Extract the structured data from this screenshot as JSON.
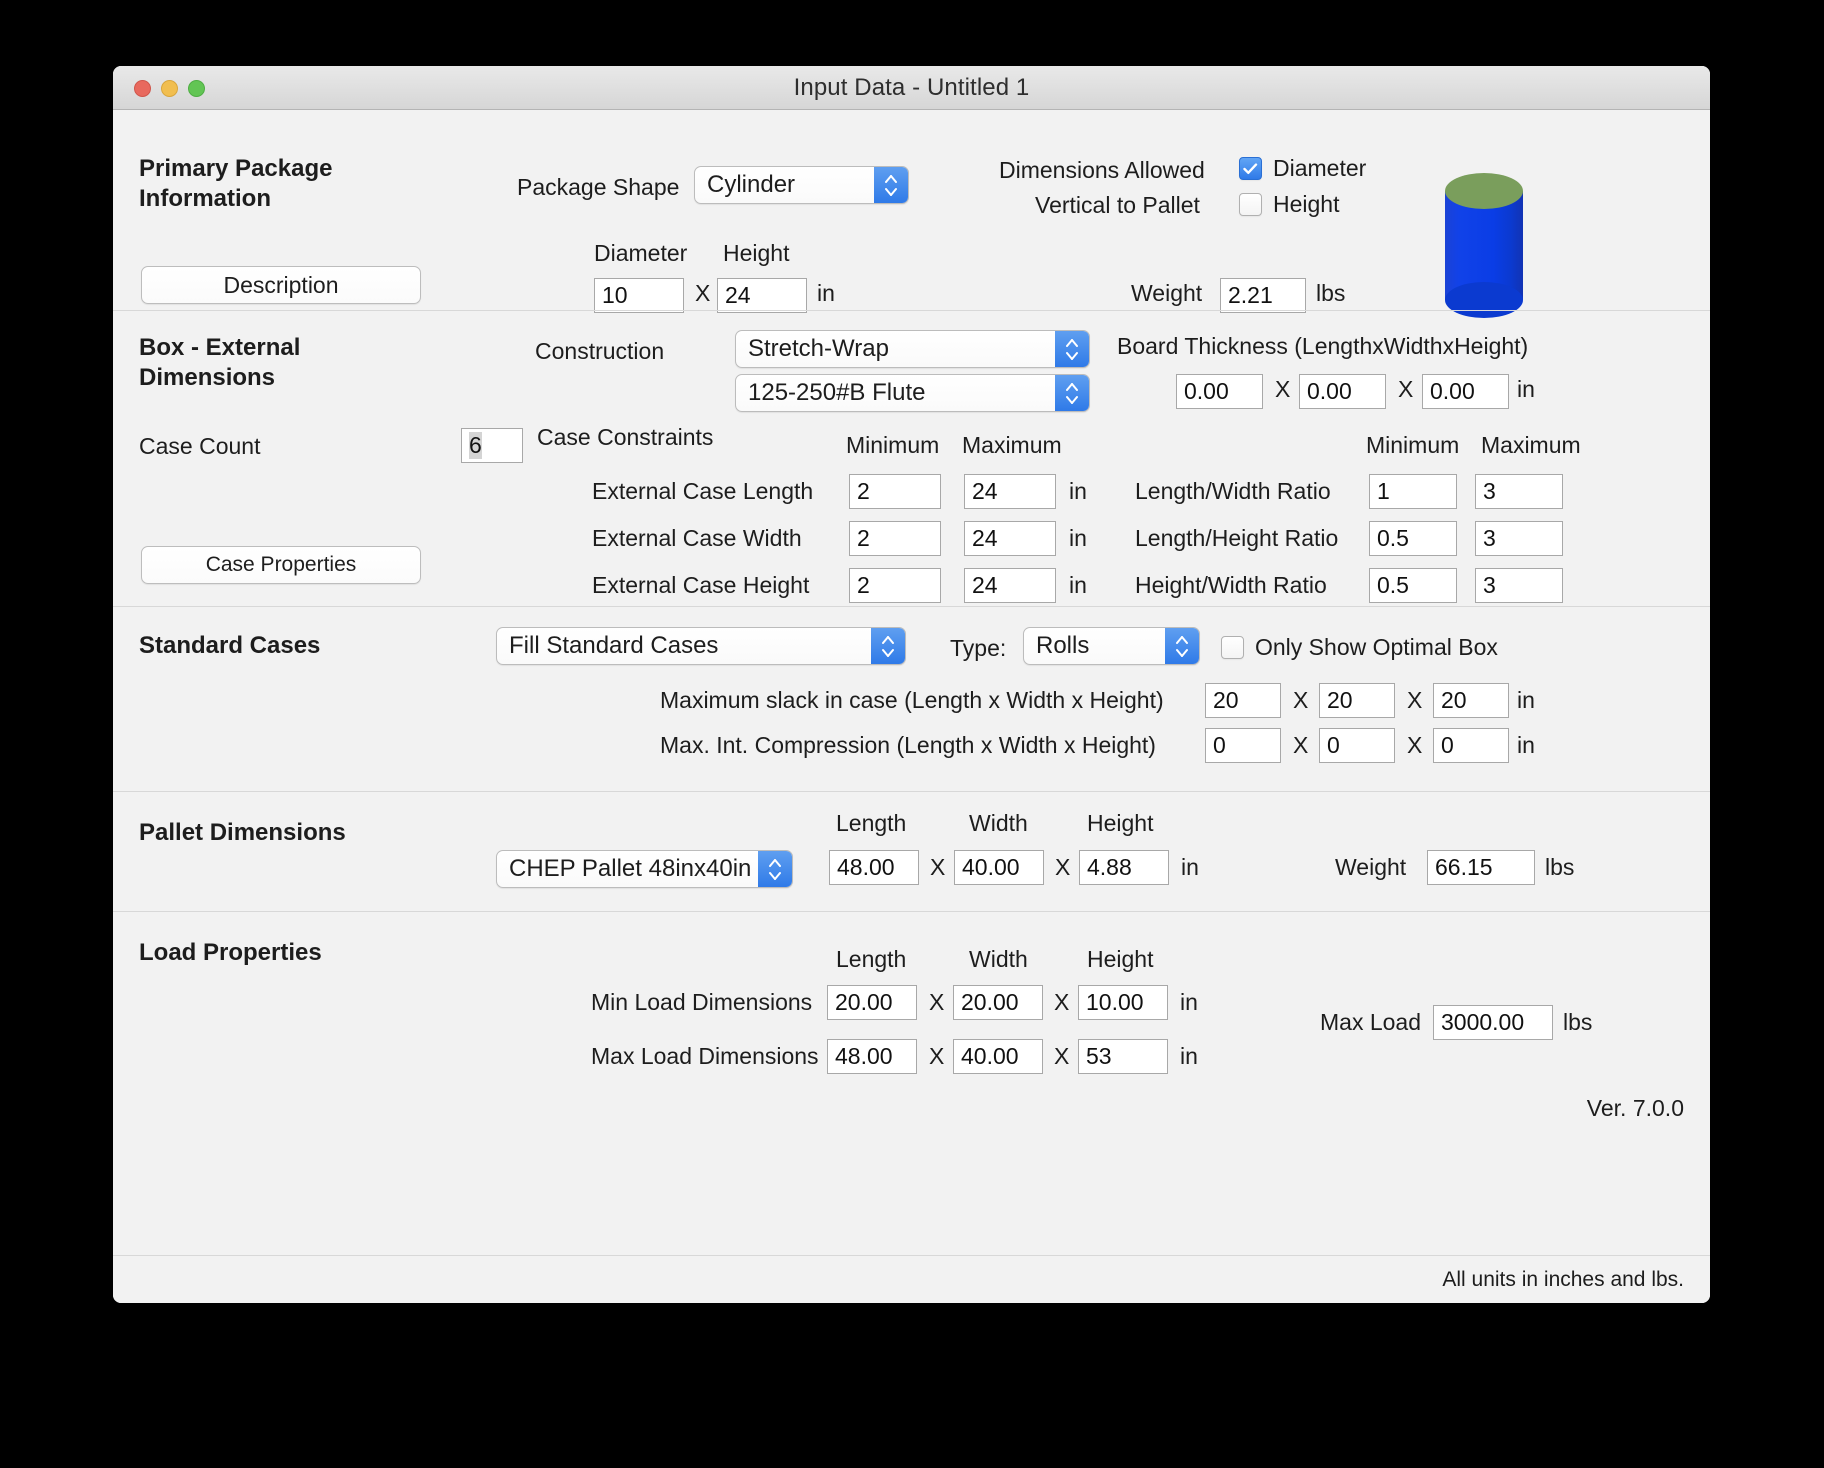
{
  "window": {
    "title": "Input Data - Untitled 1",
    "traffic_lights": [
      "close",
      "minimize",
      "zoom"
    ]
  },
  "primary_package": {
    "section_title": "Primary Package\nInformation",
    "description_button": "Description",
    "package_shape_label": "Package Shape",
    "package_shape_value": "Cylinder",
    "diameter_label": "Diameter",
    "height_label": "Height",
    "diameter_value": "10",
    "height_value": "24",
    "x_sep": "X",
    "unit_in": "in",
    "dims_allowed_line1": "Dimensions Allowed",
    "dims_allowed_line2": "Vertical to Pallet",
    "check_diameter_label": "Diameter",
    "check_diameter_checked": true,
    "check_height_label": "Height",
    "check_height_checked": false,
    "weight_label": "Weight",
    "weight_value": "2.21",
    "weight_unit": "lbs",
    "shape_preview": "cylinder",
    "shape_color_body": "#0a3de6",
    "shape_color_top": "#7a9e5c"
  },
  "box_external": {
    "section_title": "Box - External\nDimensions",
    "construction_label": "Construction",
    "construction_value": "Stretch-Wrap",
    "flute_value": "125-250#B Flute",
    "board_thickness_label": "Board Thickness (LengthxWidthxHeight)",
    "board_thickness": [
      "0.00",
      "0.00",
      "0.00"
    ],
    "board_thickness_unit": "in",
    "case_count_label": "Case Count",
    "case_count_value": "6",
    "case_properties_button": "Case Properties",
    "case_constraints_label": "Case Constraints",
    "minimum_header": "Minimum",
    "maximum_header": "Maximum",
    "constraints": [
      {
        "label": "External Case Length",
        "min": "2",
        "max": "24",
        "unit": "in"
      },
      {
        "label": "External Case Width",
        "min": "2",
        "max": "24",
        "unit": "in"
      },
      {
        "label": "External Case Height",
        "min": "2",
        "max": "24",
        "unit": "in"
      }
    ],
    "ratios_minimum_header": "Minimum",
    "ratios_maximum_header": "Maximum",
    "ratios": [
      {
        "label": "Length/Width Ratio",
        "min": "1",
        "max": "3"
      },
      {
        "label": "Length/Height Ratio",
        "min": "0.5",
        "max": "3"
      },
      {
        "label": "Height/Width Ratio",
        "min": "0.5",
        "max": "3"
      }
    ]
  },
  "standard_cases": {
    "section_title": "Standard Cases",
    "fill_mode_value": "Fill Standard Cases",
    "type_label": "Type:",
    "type_value": "Rolls",
    "only_optimal_label": "Only Show Optimal Box",
    "only_optimal_checked": false,
    "slack_label": "Maximum slack in case  (Length x Width x Height)",
    "slack_values": [
      "20",
      "20",
      "20"
    ],
    "slack_unit": "in",
    "compression_label": "Max. Int. Compression (Length x Width x Height)",
    "compression_values": [
      "0",
      "0",
      "0"
    ],
    "compression_unit": "in",
    "x_sep": "X"
  },
  "pallet": {
    "section_title": "Pallet Dimensions",
    "pallet_value": "CHEP Pallet 48inx40in",
    "length_header": "Length",
    "width_header": "Width",
    "height_header": "Height",
    "length_value": "48.00",
    "width_value": "40.00",
    "height_value": "4.88",
    "unit_in": "in",
    "x_sep": "X",
    "weight_label": "Weight",
    "weight_value": "66.15",
    "weight_unit": "lbs"
  },
  "load": {
    "section_title": "Load Properties",
    "length_header": "Length",
    "width_header": "Width",
    "height_header": "Height",
    "min_label": "Min Load Dimensions",
    "min_values": [
      "20.00",
      "20.00",
      "10.00"
    ],
    "max_label": "Max Load Dimensions",
    "max_values": [
      "48.00",
      "40.00",
      "53"
    ],
    "unit_in": "in",
    "x_sep": "X",
    "max_load_label": "Max Load",
    "max_load_value": "3000.00",
    "max_load_unit": "lbs"
  },
  "footer": {
    "version": "Ver. 7.0.0",
    "units_note": "All units in inches and lbs."
  }
}
